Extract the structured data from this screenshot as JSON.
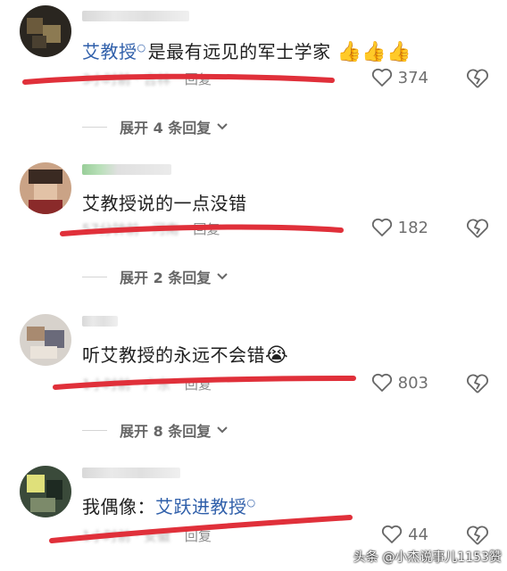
{
  "comments": [
    {
      "text_mention": "艾教授",
      "text_rest": "是最有远见的军士学家",
      "meta_time": "3小时前 · 吉林",
      "reply_label": "回复",
      "likes": "374",
      "expand": "展开 4 条回复"
    },
    {
      "text": "艾教授说的一点没错",
      "meta_time": "57分钟前 · 河南",
      "reply_label": "回复",
      "likes": "182",
      "expand": "展开 2 条回复"
    },
    {
      "text": "听艾教授的永远不会错",
      "meta_time": "1小时前 · 广东",
      "reply_label": "回复",
      "likes": "803",
      "expand": "展开 8 条回复"
    },
    {
      "text_prefix": "我偶像：",
      "text_mention": "艾跃进教授",
      "meta_time": "1小时前 · 安徽",
      "reply_label": "回复",
      "likes": "44"
    }
  ],
  "watermark": "头条 @小杰说事儿1153赞",
  "colors": {
    "mention": "#2f5faa",
    "underline": "#e0303a",
    "thumbs": "#f2a51c"
  },
  "icons": [
    "heart-outline-icon",
    "broken-heart-icon",
    "thumbs-up-icon",
    "crying-face-icon",
    "chevron-down-icon",
    "search-mention-icon"
  ]
}
